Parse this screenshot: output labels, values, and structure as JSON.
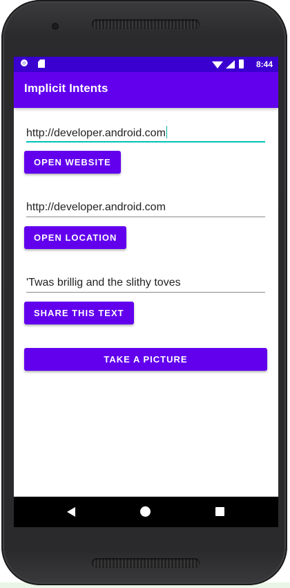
{
  "status_bar": {
    "time": "8:44",
    "icons": [
      "notification-dot-icon",
      "sd-card-icon",
      "wifi-icon",
      "signal-icon",
      "battery-icon"
    ]
  },
  "app_bar": {
    "title": "Implicit Intents",
    "color": "#6200ee"
  },
  "fields": {
    "website_url": "http://developer.android.com",
    "location": "http://developer.android.com",
    "share_text": "'Twas brillig and the slithy toves"
  },
  "buttons": {
    "open_website": "OPEN WEBSITE",
    "open_location": "OPEN LOCATION",
    "share_text": "SHARE THIS TEXT",
    "take_picture": "TAKE A PICTURE"
  },
  "nav_bar": {
    "icons": [
      "back-icon",
      "home-icon",
      "recents-icon"
    ]
  },
  "colors": {
    "status_bar": "#3a00d0",
    "primary": "#6200ee",
    "focus_underline": "#00c2b8"
  }
}
